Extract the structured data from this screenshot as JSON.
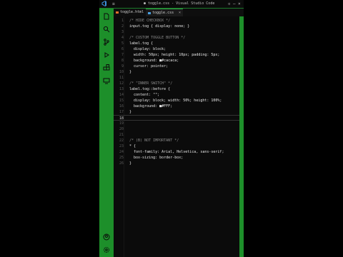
{
  "titlebar": {
    "menu_icon": "hamburger-icon",
    "title": "● toggle.css - Visual Studio Code",
    "controls": [
      "layout-icon",
      "minimize-icon",
      "close-icon"
    ]
  },
  "tabs": [
    {
      "label": "toggle.html",
      "active": false
    },
    {
      "label": "toggle.css",
      "active": true
    }
  ],
  "activity_icons": [
    "explorer-icon",
    "search-icon",
    "source-control-icon",
    "run-icon",
    "extensions-icon",
    "remote-icon"
  ],
  "bottom_icons": [
    "account-icon",
    "settings-icon"
  ],
  "colors": {
    "accent": "#1d8f2a",
    "swatch1": "#cacaca",
    "swatch2": "#ffffff"
  },
  "lines": [
    {
      "n": "1",
      "text": "/* HIDE CHECKBOX */",
      "cls": "cm"
    },
    {
      "n": "2",
      "text": "input.tog { display: none; }"
    },
    {
      "n": "3",
      "text": ""
    },
    {
      "n": "4",
      "text": "/* CUSTOM TOGGLE BUTTON */",
      "cls": "cm"
    },
    {
      "n": "5",
      "text": "label.tog {"
    },
    {
      "n": "6",
      "text": "  display: block;"
    },
    {
      "n": "7",
      "text": "  width: 50px; height: 10px; padding: 5px;"
    },
    {
      "n": "8",
      "text": "  background: ■#cacaca;"
    },
    {
      "n": "9",
      "text": "  cursor: pointer;"
    },
    {
      "n": "10",
      "text": "}"
    },
    {
      "n": "11",
      "text": ""
    },
    {
      "n": "12",
      "text": "/* \"INNER SWITCH\" */",
      "cls": "cm"
    },
    {
      "n": "13",
      "text": "label.tog::before {"
    },
    {
      "n": "14",
      "text": "  content: \"\";"
    },
    {
      "n": "15",
      "text": "  display: block; width: 50%; height: 100%;"
    },
    {
      "n": "16",
      "text": "  background: ■#FFF;"
    },
    {
      "n": "17",
      "text": "}"
    },
    {
      "n": "18",
      "text": "",
      "current": true
    },
    {
      "n": "19",
      "text": ""
    },
    {
      "n": "20",
      "text": ""
    },
    {
      "n": "21",
      "text": ""
    },
    {
      "n": "22",
      "text": "/* (B) NOT IMPORTANT */",
      "cls": "cm"
    },
    {
      "n": "23",
      "text": "* {"
    },
    {
      "n": "24",
      "text": "  font-family: Arial, Helvetica, sans-serif;"
    },
    {
      "n": "25",
      "text": "  box-sizing: border-box;"
    },
    {
      "n": "26",
      "text": "}"
    }
  ]
}
